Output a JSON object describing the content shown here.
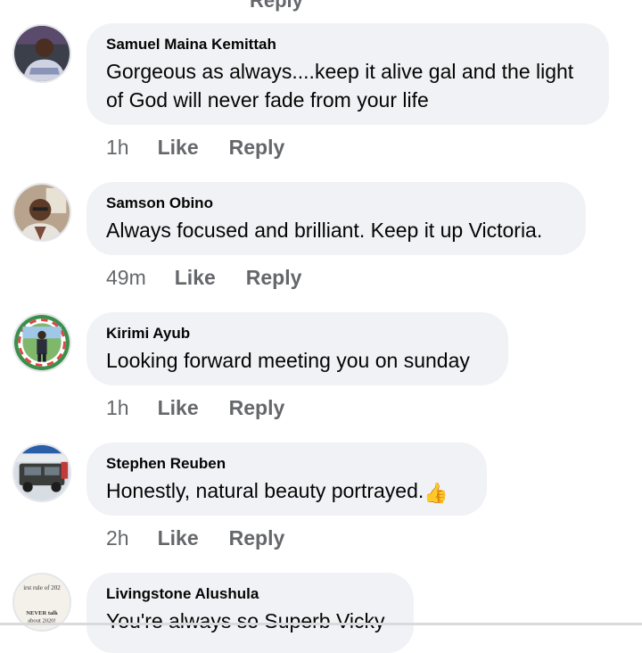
{
  "top_clipped": {
    "label": "Reply"
  },
  "comments": [
    {
      "author": "Samuel Maina Kemittah",
      "text": "Gorgeous as always....keep it alive gal and the light of God will never fade from your life",
      "time": "1h",
      "like_label": "Like",
      "reply_label": "Reply"
    },
    {
      "author": "Samson Obino",
      "text": "Always focused and brilliant. Keep it up Victoria.",
      "time": "49m",
      "like_label": "Like",
      "reply_label": "Reply"
    },
    {
      "author": "Kirimi Ayub",
      "text": "Looking forward meeting you on sunday",
      "time": "1h",
      "like_label": "Like",
      "reply_label": "Reply"
    },
    {
      "author": "Stephen Reuben",
      "text": "Honestly, natural beauty portrayed.",
      "emoji": "👍",
      "time": "2h",
      "like_label": "Like",
      "reply_label": "Reply"
    },
    {
      "author": "Livingstone Alushula",
      "text": "You're always so Superb Vicky",
      "avatar_text": [
        "irst rule of 202",
        "NEVER talk",
        "about 2020!"
      ]
    }
  ],
  "colors": {
    "bubble_bg": "#f0f2f5",
    "meta_text": "#65676b",
    "primary_text": "#050505"
  }
}
